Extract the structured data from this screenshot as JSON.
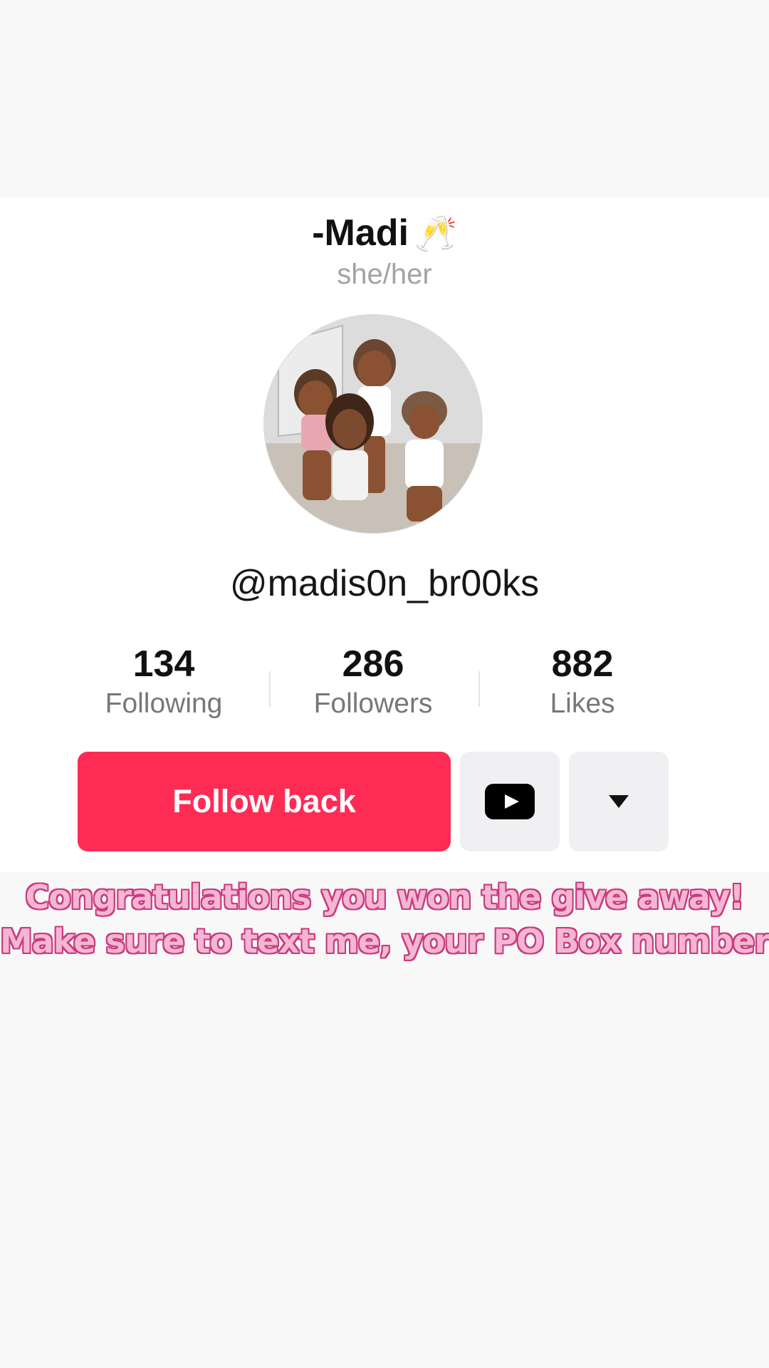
{
  "profile": {
    "display_name": "-Madi",
    "name_emoji": "🥂",
    "pronouns": "she/her",
    "username": "@madis0n_br00ks"
  },
  "stats": [
    {
      "value": "134",
      "label": "Following"
    },
    {
      "value": "286",
      "label": "Followers"
    },
    {
      "value": "882",
      "label": "Likes"
    }
  ],
  "actions": {
    "follow_label": "Follow back",
    "youtube_icon": "youtube-icon",
    "more_icon": "caret-down-icon"
  },
  "colors": {
    "follow_button": "#fe2c55",
    "secondary_button": "#f0f0f3",
    "overlay_fill": "#f3b6d4",
    "overlay_outline": "#c93a7d"
  },
  "overlay_text": {
    "line1": "Congratulations you won the give away!",
    "line2": "Make sure to text me, your PO Box number!"
  }
}
